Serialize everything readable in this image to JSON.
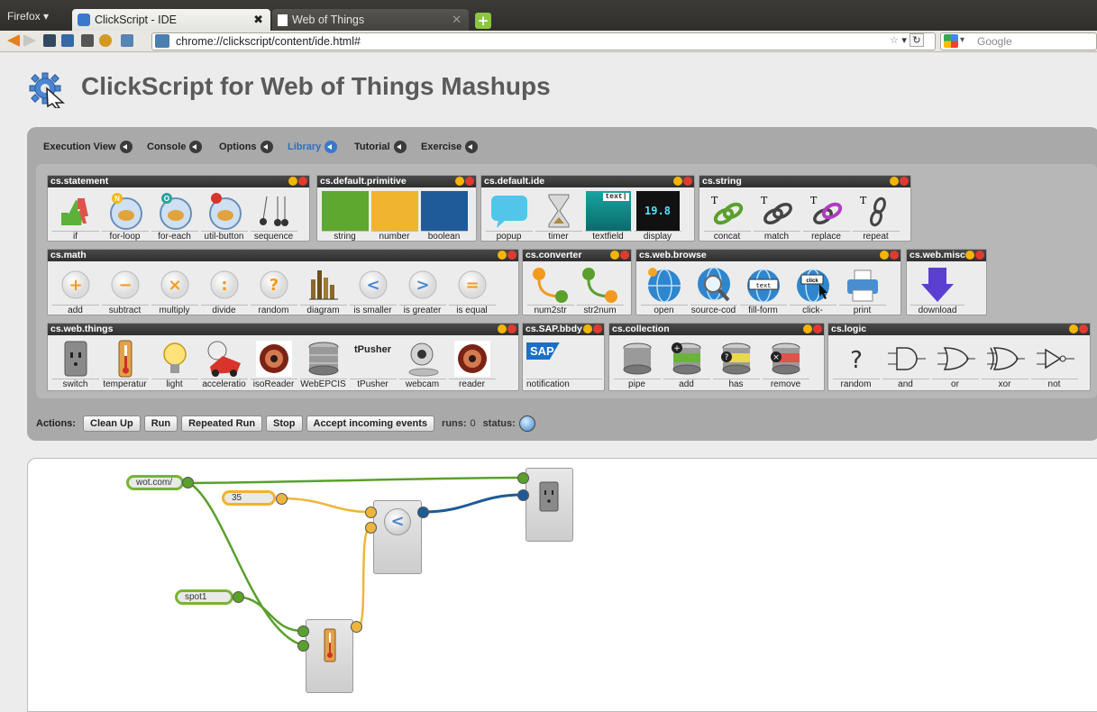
{
  "browser": {
    "app_menu": "Firefox",
    "tabs": [
      {
        "label": "ClickScript - IDE",
        "active": true
      },
      {
        "label": "Web of Things",
        "active": false
      }
    ],
    "url": "chrome://clickscript/content/ide.html#",
    "search_placeholder": "Google"
  },
  "page": {
    "title": "ClickScript for Web of Things Mashups",
    "menu": [
      {
        "label": "Execution View",
        "active": false
      },
      {
        "label": "Console",
        "active": false
      },
      {
        "label": "Options",
        "active": false
      },
      {
        "label": "Library",
        "active": true
      },
      {
        "label": "Tutorial",
        "active": false
      },
      {
        "label": "Exercise",
        "active": false
      }
    ]
  },
  "libraries": {
    "statement": {
      "title": "cs.statement",
      "items": [
        "if",
        "for-loop",
        "for-each",
        "util-button",
        "sequence"
      ]
    },
    "primitive": {
      "title": "cs.default.primitive",
      "items": [
        "string",
        "number",
        "boolean"
      ]
    },
    "ide": {
      "title": "cs.default.ide",
      "items": [
        "popup",
        "timer",
        "textfield",
        "display"
      ]
    },
    "string": {
      "title": "cs.string",
      "items": [
        "concat",
        "match",
        "replace",
        "repeat"
      ]
    },
    "math": {
      "title": "cs.math",
      "items": [
        "add",
        "subtract",
        "multiply",
        "divide",
        "random",
        "diagram",
        "is smaller",
        "is greater",
        "is equal"
      ]
    },
    "converter": {
      "title": "cs.converter",
      "items": [
        "num2str",
        "str2num"
      ]
    },
    "browse": {
      "title": "cs.web.browse",
      "items": [
        "open",
        "source-cod",
        "fill-form",
        "click-",
        "print"
      ]
    },
    "misc": {
      "title": "cs.web.misc",
      "items": [
        "download"
      ]
    },
    "things": {
      "title": "cs.web.things",
      "items": [
        "switch",
        "temperatur",
        "light",
        "acceleratio",
        "isoReader",
        "WebEPCIS",
        "tPusher",
        "webcam",
        "reader"
      ]
    },
    "sap": {
      "title": "cs.SAP.bbdy",
      "items": [
        "notification"
      ]
    },
    "collection": {
      "title": "cs.collection",
      "items": [
        "pipe",
        "add",
        "has",
        "remove"
      ]
    },
    "logic": {
      "title": "cs.logic",
      "items": [
        "random",
        "and",
        "or",
        "xor",
        "not"
      ]
    }
  },
  "icon_text": {
    "textfield": "text|",
    "display": "19.8",
    "sap": "SAP",
    "tpusher": "tPusher",
    "browse_fill": "text",
    "browse_click": "click"
  },
  "actions": {
    "label": "Actions:",
    "buttons": [
      "Clean Up",
      "Run",
      "Repeated Run",
      "Stop",
      "Accept incoming events"
    ],
    "runs_label": "runs:",
    "runs_value": "0",
    "status_label": "status:"
  },
  "canvas": {
    "inputs": [
      {
        "id": "url",
        "value": "wot.com/"
      },
      {
        "id": "threshold",
        "value": "35"
      },
      {
        "id": "spot",
        "value": "spot1"
      }
    ],
    "compare_symbol": "<"
  },
  "colors": {
    "wire_green": "#5aa02c",
    "wire_orange": "#efb53a",
    "wire_blue": "#1d5b95",
    "accent": "#3a79c9"
  }
}
